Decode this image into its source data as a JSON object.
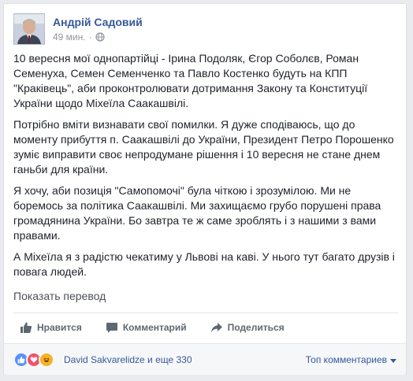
{
  "post": {
    "author": "Андрій Садовий",
    "time": "49 мин.",
    "separator": "·",
    "paragraphs": [
      "10 вересня мої однопартійці - Ірина Подоляк, Єгор Соболєв, Роман Семенуха, Семен Семенченко та Павло Костенко будуть на КПП \"Краківець\", аби проконтролювати дотримання Закону та Конституції України щодо Міхеїла Саакашвілі.",
      "Потрібно вміти визнавати свої помилки. Я дуже сподіваюсь, що до моменту прибуття п. Саакашвілі до України, Президент Петро Порошенко зуміє виправити своє непродумане рішення і 10 вересня не стане днем ганьби для країни.",
      "Я хочу, аби позиція \"Самопомочі\" була чіткою і зрозумілою. Ми не боремось за політика Саакашвілі. Ми захищаємо грубо порушені права громадянина України. Бо завтра те ж саме зроблять і з нашими з вами правами.",
      "А Міхеїла я з радістю чекатиму у Львові на каві. У нього тут багато друзів і повага людей."
    ],
    "translate_link": "Показать перевод"
  },
  "actions": {
    "like": "Нравится",
    "comment": "Комментарий",
    "share": "Поделиться"
  },
  "reactions": {
    "summary": "David Sakvarelidze и еще 330",
    "sort": "Топ комментариев"
  },
  "colors": {
    "link": "#365899",
    "text": "#1d2129",
    "muted": "#90949c",
    "like": "#5890ff",
    "love": "#f25268",
    "haha": "#f7b125"
  }
}
